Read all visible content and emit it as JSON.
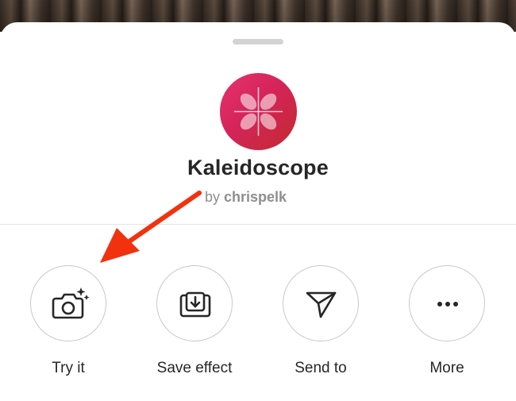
{
  "effect": {
    "title": "Kaleidoscope",
    "author_prefix": "by",
    "author_handle": "chrispelk"
  },
  "actions": [
    {
      "label": "Try it",
      "icon": "camera-sparkle-icon"
    },
    {
      "label": "Save effect",
      "icon": "save-download-icon"
    },
    {
      "label": "Send to",
      "icon": "paper-plane-icon"
    },
    {
      "label": "More",
      "icon": "more-dots-icon"
    }
  ],
  "colors": {
    "icon_gradient_start": "#e8326e",
    "icon_gradient_end": "#c42a2e",
    "annotation_arrow": "#f2310f",
    "text_primary": "#262626",
    "text_secondary": "#8e8e8e"
  }
}
